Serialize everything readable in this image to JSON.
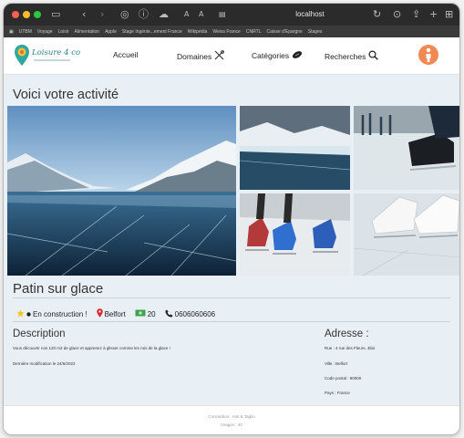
{
  "browser": {
    "url": "localhost",
    "bookmarks": [
      "UTBM",
      "Voyage",
      "Loisir",
      "Alimentation",
      "Apple",
      "Stage Ingénie...ement France",
      "Wikipédia",
      "Weiss France",
      "CNRTL",
      "Caisse d'Epargne",
      "Stages"
    ]
  },
  "nav": {
    "logo_text": "Loisure 4 co",
    "items": [
      "Accueil",
      "Domaines",
      "Catégories",
      "Recherches"
    ]
  },
  "page": {
    "title": "Voici votre activité",
    "activity": {
      "name": "Patin sur glace",
      "status": "En construction !",
      "city": "Belfort",
      "price": "20",
      "phone": "0606060606"
    },
    "description": {
      "heading": "Description",
      "text": "Vous découvrir nos 120 m2 de glace et apprenez à glisser comme les rois de la glace !",
      "modified": "Dernière modification le 24/6/2022"
    },
    "address": {
      "heading": "Adresse :",
      "street": "Rue : 4 rue des Fleurs, 4bis",
      "city": "Ville : Belfort",
      "postal": "Code postal : 90000",
      "country": "Pays : France"
    }
  },
  "footer": {
    "line1": "Conception : Anti & Taglio",
    "line2": "Images : 40"
  },
  "colors": {
    "page_bg": "#e9f0f5",
    "avatar": "#f08a54",
    "location_pin": "#d9252b",
    "star": "#f5c518",
    "money": "#3ea34a"
  }
}
